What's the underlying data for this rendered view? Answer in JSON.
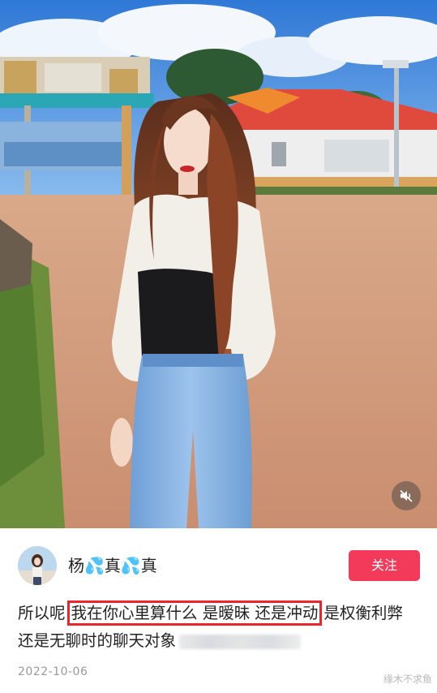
{
  "author": {
    "name": "杨💦真💦真",
    "follow_label": "关注"
  },
  "caption": {
    "prefix": "所以呢",
    "highlighted": "我在你心里算什么 是暧昧 还是冲动",
    "suffix": "是权衡利弊",
    "line2": "还是无聊时的聊天对象"
  },
  "post_date": "2022-10-06",
  "watermark": "缘木不求鱼",
  "icons": {
    "mute": "speaker-muted-icon"
  },
  "colors": {
    "follow_button": "#f33a5a",
    "highlight_border": "#e8262c"
  }
}
